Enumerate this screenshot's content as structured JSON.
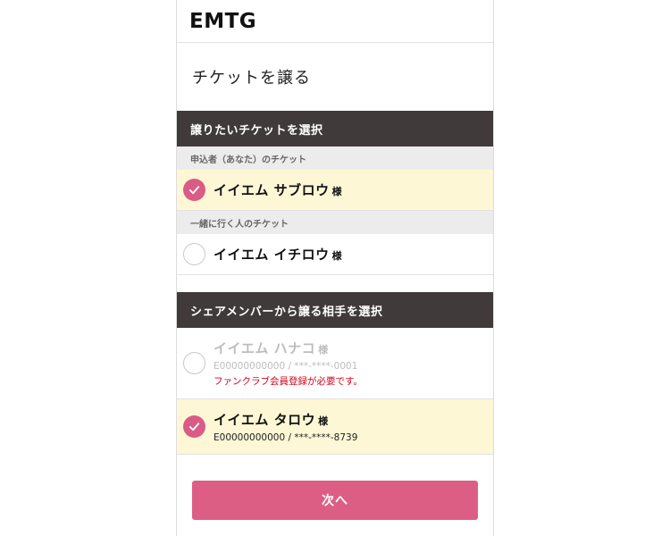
{
  "header": {
    "logo": "EMTG"
  },
  "page": {
    "title": "チケットを譲る"
  },
  "section_ticket": {
    "title": "譲りたいチケットを選択",
    "groups": [
      {
        "label": "申込者（あなた）のチケット",
        "name": "イイエム サブロウ",
        "honorific": "様",
        "selected": true
      },
      {
        "label": "一緒に行く人のチケット",
        "name": "イイエム イチロウ",
        "honorific": "様",
        "selected": false
      }
    ]
  },
  "section_recipient": {
    "title": "シェアメンバーから譲る相手を選択",
    "members": [
      {
        "name": "イイエム ハナコ",
        "honorific": "様",
        "member_id": "E00000000000 / ***-****-0001",
        "warning": "ファンクラブ会員登録が必要です。",
        "disabled": true,
        "selected": false
      },
      {
        "name": "イイエム タロウ",
        "honorific": "様",
        "member_id": "E00000000000 / ***-****-8739",
        "disabled": false,
        "selected": true
      }
    ]
  },
  "footer": {
    "next_label": "次へ"
  },
  "colors": {
    "accent": "#d95b86",
    "section_bg": "#403b3a",
    "selected_bg": "#fdf7d6",
    "warning": "#d0021b"
  }
}
